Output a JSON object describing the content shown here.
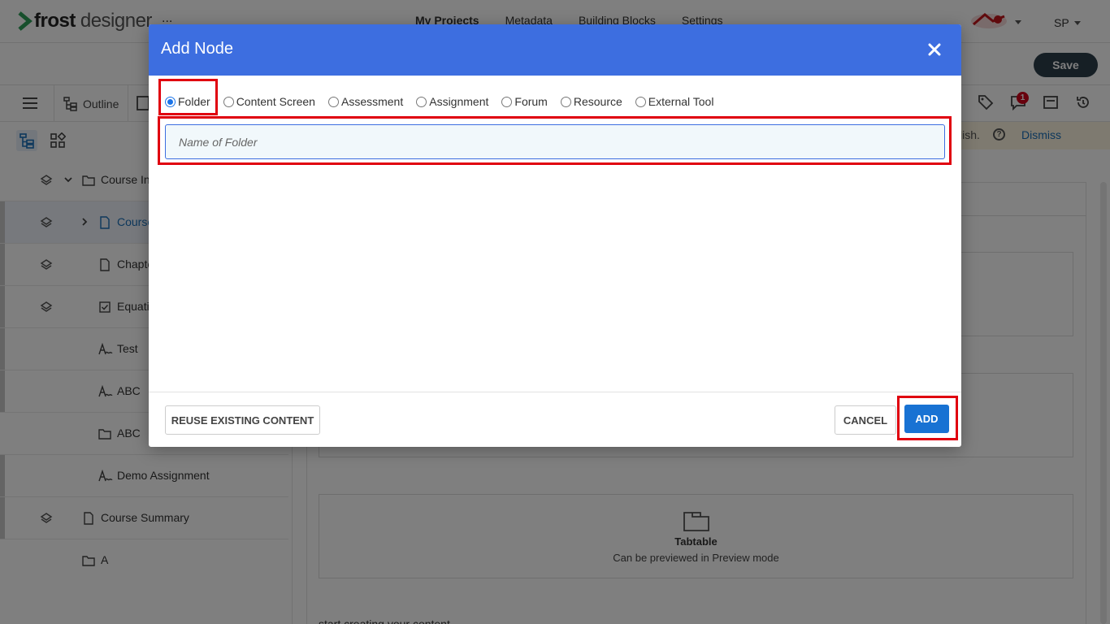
{
  "app": {
    "logo_bold": "frost",
    "logo_light": "designer",
    "logo_menu": "..."
  },
  "nav": {
    "items": [
      "My Projects",
      "Metadata",
      "Building Blocks",
      "Settings"
    ],
    "user_initials": "SP"
  },
  "header": {
    "save_label": "Save"
  },
  "toolbar": {
    "outline_label": "Outline",
    "notification_count": "1"
  },
  "notice": {
    "text_fragment": "lish.",
    "dismiss_label": "Dismiss"
  },
  "sidebar": {
    "items": [
      {
        "label": "Course In",
        "icon": "folder-icon",
        "expanded": true
      },
      {
        "label": "Course",
        "icon": "file-icon",
        "selected": true
      },
      {
        "label": "Chapte",
        "icon": "file-icon"
      },
      {
        "label": "Equati",
        "icon": "checkbox-icon"
      },
      {
        "label": "Test",
        "icon": "assignment-icon"
      },
      {
        "label": "ABC",
        "icon": "assignment-icon"
      },
      {
        "label": "ABC",
        "icon": "folder-icon"
      },
      {
        "label": "Demo Assignment",
        "icon": "assignment-icon"
      },
      {
        "label": "Course Summary",
        "icon": "file-icon"
      },
      {
        "label": "A",
        "icon": "folder-icon"
      }
    ]
  },
  "canvas": {
    "tabtable_title": "Tabtable",
    "tabtable_sub": "Can be previewed in Preview mode",
    "start_text": "start creating your content"
  },
  "modal": {
    "title": "Add Node",
    "node_types": [
      "Folder",
      "Content Screen",
      "Assessment",
      "Assignment",
      "Forum",
      "Resource",
      "External Tool"
    ],
    "selected_type": "Folder",
    "name_placeholder": "Name of Folder",
    "name_value": "",
    "reuse_label": "REUSE EXISTING CONTENT",
    "cancel_label": "CANCEL",
    "add_label": "ADD"
  },
  "colors": {
    "modal_header": "#3d6ee0",
    "primary_button": "#1872d3",
    "highlight": "#e0000f",
    "save_button": "#2d3e4a"
  }
}
